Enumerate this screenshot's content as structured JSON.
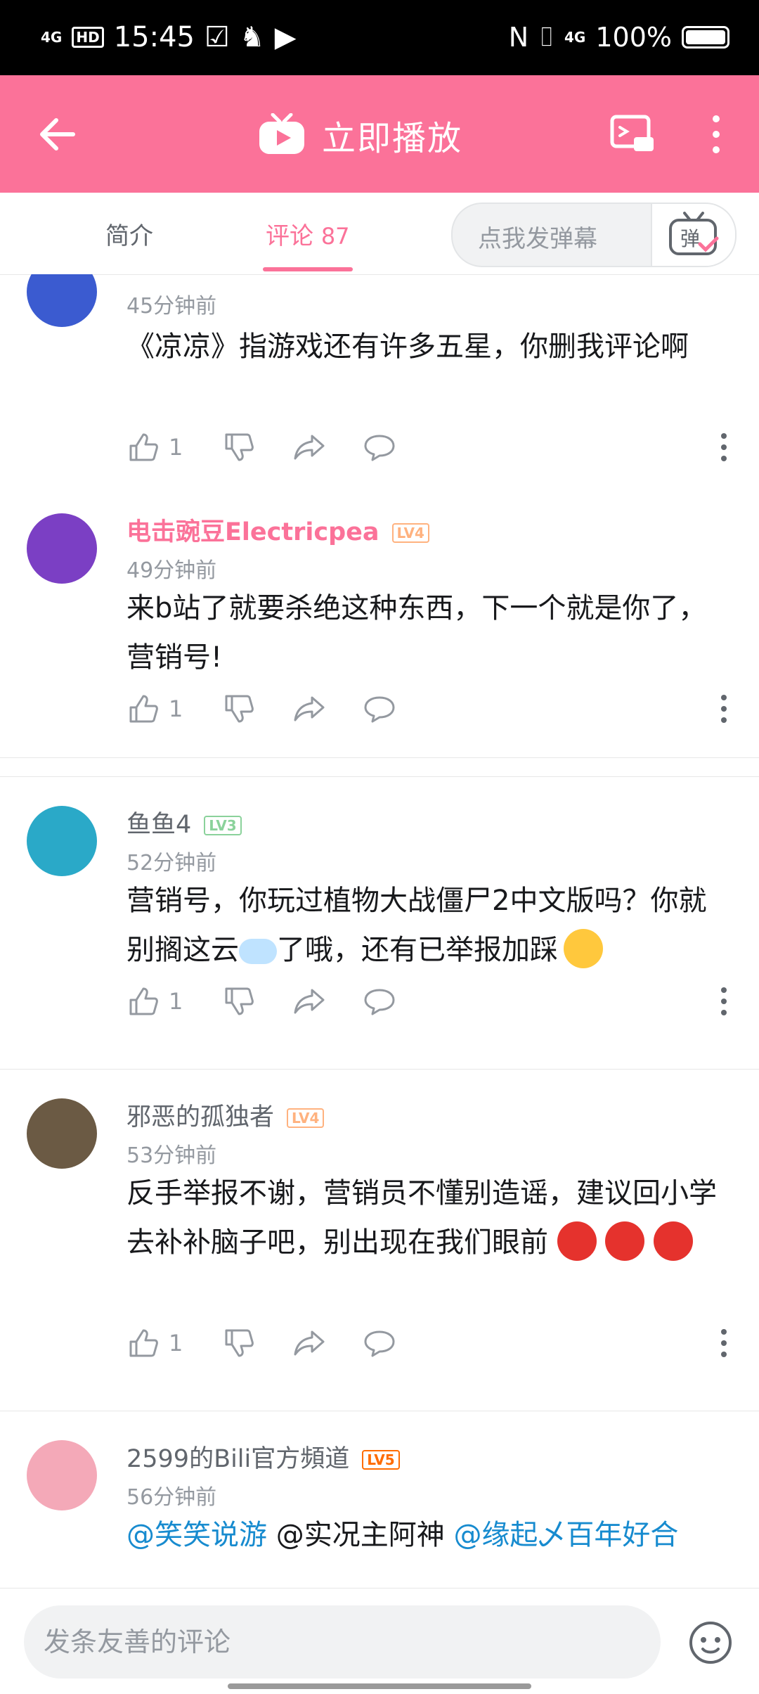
{
  "status_bar": {
    "signal_label": "4G",
    "hd_label": "HD",
    "time": "15:45",
    "right_signal_label": "4G",
    "battery_text": "100%"
  },
  "header": {
    "play_title": "立即播放"
  },
  "tabs": {
    "intro_label": "简介",
    "comments_label": "评论",
    "comments_count": "87",
    "danmu_placeholder": "点我发弹幕",
    "danmu_button_glyph": "弹"
  },
  "comments": [
    {
      "time": "45分钟前",
      "text": "《凉凉》指游戏还有许多五星，你删我评论啊",
      "likes": "1"
    },
    {
      "username": "电击豌豆Electricpea",
      "level": "LV4",
      "time": "49分钟前",
      "text": "来b站了就要杀绝这种东西，下一个就是你了，营销号!",
      "likes": "1"
    },
    {
      "username": "鱼鱼4",
      "level": "LV3",
      "time": "52分钟前",
      "text_before": "营销号，你玩过植物大战僵尸2中文版吗？你就别搁这云",
      "text_after": "了哦，还有已举报加踩",
      "likes": "1"
    },
    {
      "username": "邪恶的孤独者",
      "level": "LV4",
      "time": "53分钟前",
      "text": "反手举报不谢，营销员不懂别造谣，建议回小学去补补脑子吧，别出现在我们眼前",
      "likes": "1"
    },
    {
      "username": "2599的Bili官方頻道",
      "level": "LV5",
      "time": "56分钟前",
      "mention1": "@笑笑说游",
      "mention2": "@实况主阿神",
      "mention3": "@缘起乄百年好合"
    }
  ],
  "bottom": {
    "input_placeholder": "发条友善的评论"
  },
  "colors": {
    "brand_pink": "#fb7299",
    "mention_blue": "#178bcf",
    "lv4": "#ffb27f",
    "lv3": "#8bd29b",
    "lv5": "#ff6c00"
  }
}
